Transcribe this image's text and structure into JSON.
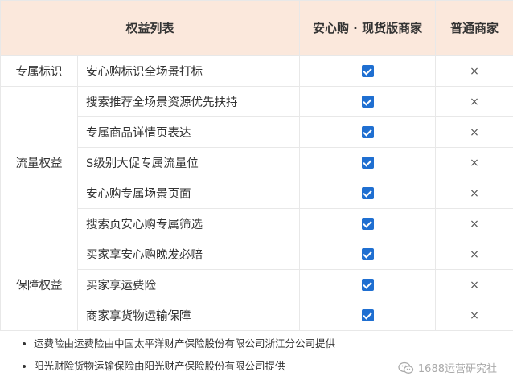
{
  "header": {
    "col_rights": "权益列表",
    "col_anxin": "安心购 · 现货版商家",
    "col_normal": "普通商家"
  },
  "groups": [
    {
      "category": "专属标识",
      "items": [
        {
          "label": "安心购标识全场景打标",
          "anxin": "check-icon",
          "normal": "×"
        }
      ]
    },
    {
      "category": "流量权益",
      "items": [
        {
          "label": "搜索推荐全场景资源优先扶持",
          "anxin": "check-icon",
          "normal": "×"
        },
        {
          "label": "专属商品详情页表达",
          "anxin": "check-icon",
          "normal": "×"
        },
        {
          "label": "S级别大促专属流量位",
          "anxin": "check-icon",
          "normal": "×"
        },
        {
          "label": "安心购专属场景页面",
          "anxin": "check-icon",
          "normal": "×"
        },
        {
          "label": "搜索页安心购专属筛选",
          "anxin": "check-icon",
          "normal": "×"
        }
      ]
    },
    {
      "category": "保障权益",
      "items": [
        {
          "label": "买家享安心购晚发必赔",
          "anxin": "check-icon",
          "normal": "×"
        },
        {
          "label": "买家享运费险",
          "anxin": "check-icon",
          "normal": "×"
        },
        {
          "label": "商家享货物运输保障",
          "anxin": "check-icon",
          "normal": "×"
        }
      ]
    }
  ],
  "notes": [
    "运费险由运费险由中国太平洋财产保险股份有限公司浙江分公司提供",
    "阳光财险货物运输保险由阳光财产保险股份有限公司提供"
  ],
  "watermark": {
    "icon": "wechat-icon",
    "text": "1688运营研究社"
  },
  "colors": {
    "header_bg": "#fbe8dc",
    "checkbox": "#1f6fd1",
    "border": "#e8e8e8"
  }
}
